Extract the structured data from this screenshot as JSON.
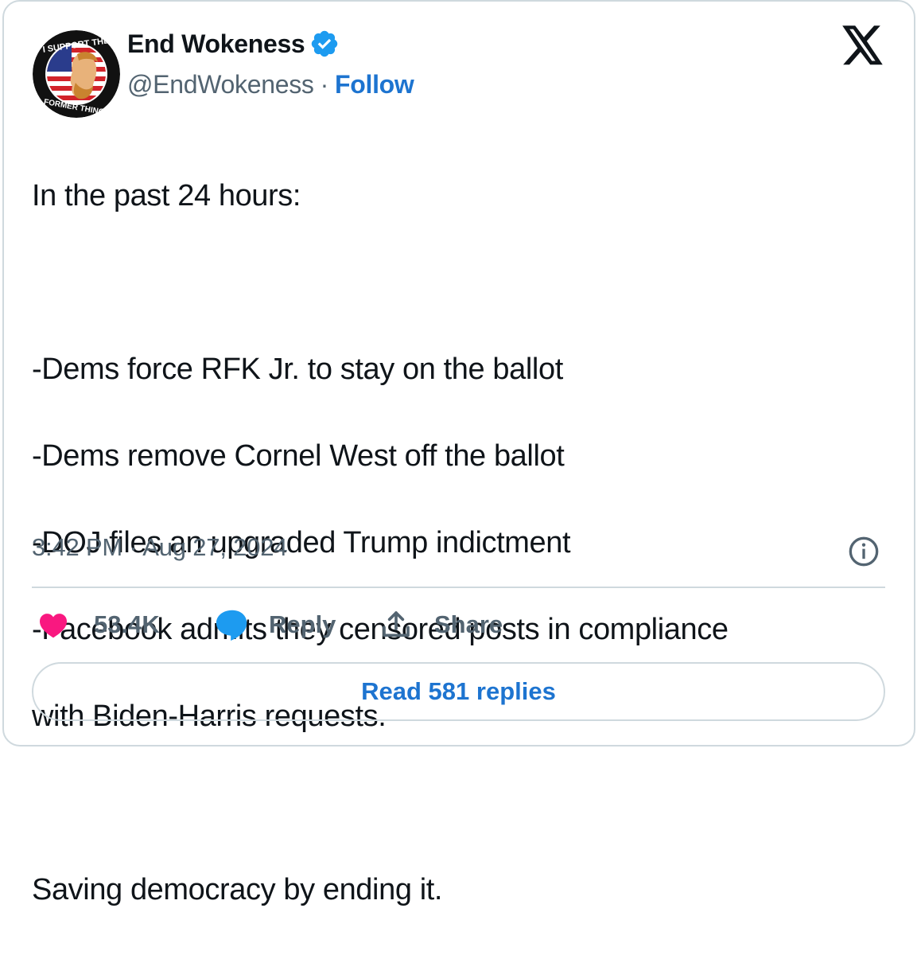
{
  "author": {
    "name": "End Wokeness",
    "handle": "@EndWokeness",
    "separator": "·",
    "follow_label": "Follow",
    "avatar_text_top": "I SUPPORT THE",
    "avatar_text_bottom": "FORMER THINGS",
    "verified_icon": "verified-badge-icon"
  },
  "tweet": {
    "lines": [
      "In the past 24 hours:",
      "",
      "-Dems force RFK Jr. to stay on the ballot",
      "-Dems remove Cornel West off the ballot",
      "-DOJ files an upgraded Trump indictment",
      "-Facebook admits they censored posts in compliance",
      "with Biden-Harris requests.",
      "",
      "Saving democracy by ending it."
    ],
    "timestamp": "3:42 PM · Aug 27, 2024"
  },
  "actions": {
    "likes_count": "53.4K",
    "reply_label": "Reply",
    "share_label": "Share",
    "read_replies_label": "Read 581 replies"
  },
  "colors": {
    "link": "#1d74d0",
    "muted": "#536471",
    "heart": "#f91880",
    "reply_bubble": "#1d9bf0",
    "border": "#cfd9de"
  }
}
